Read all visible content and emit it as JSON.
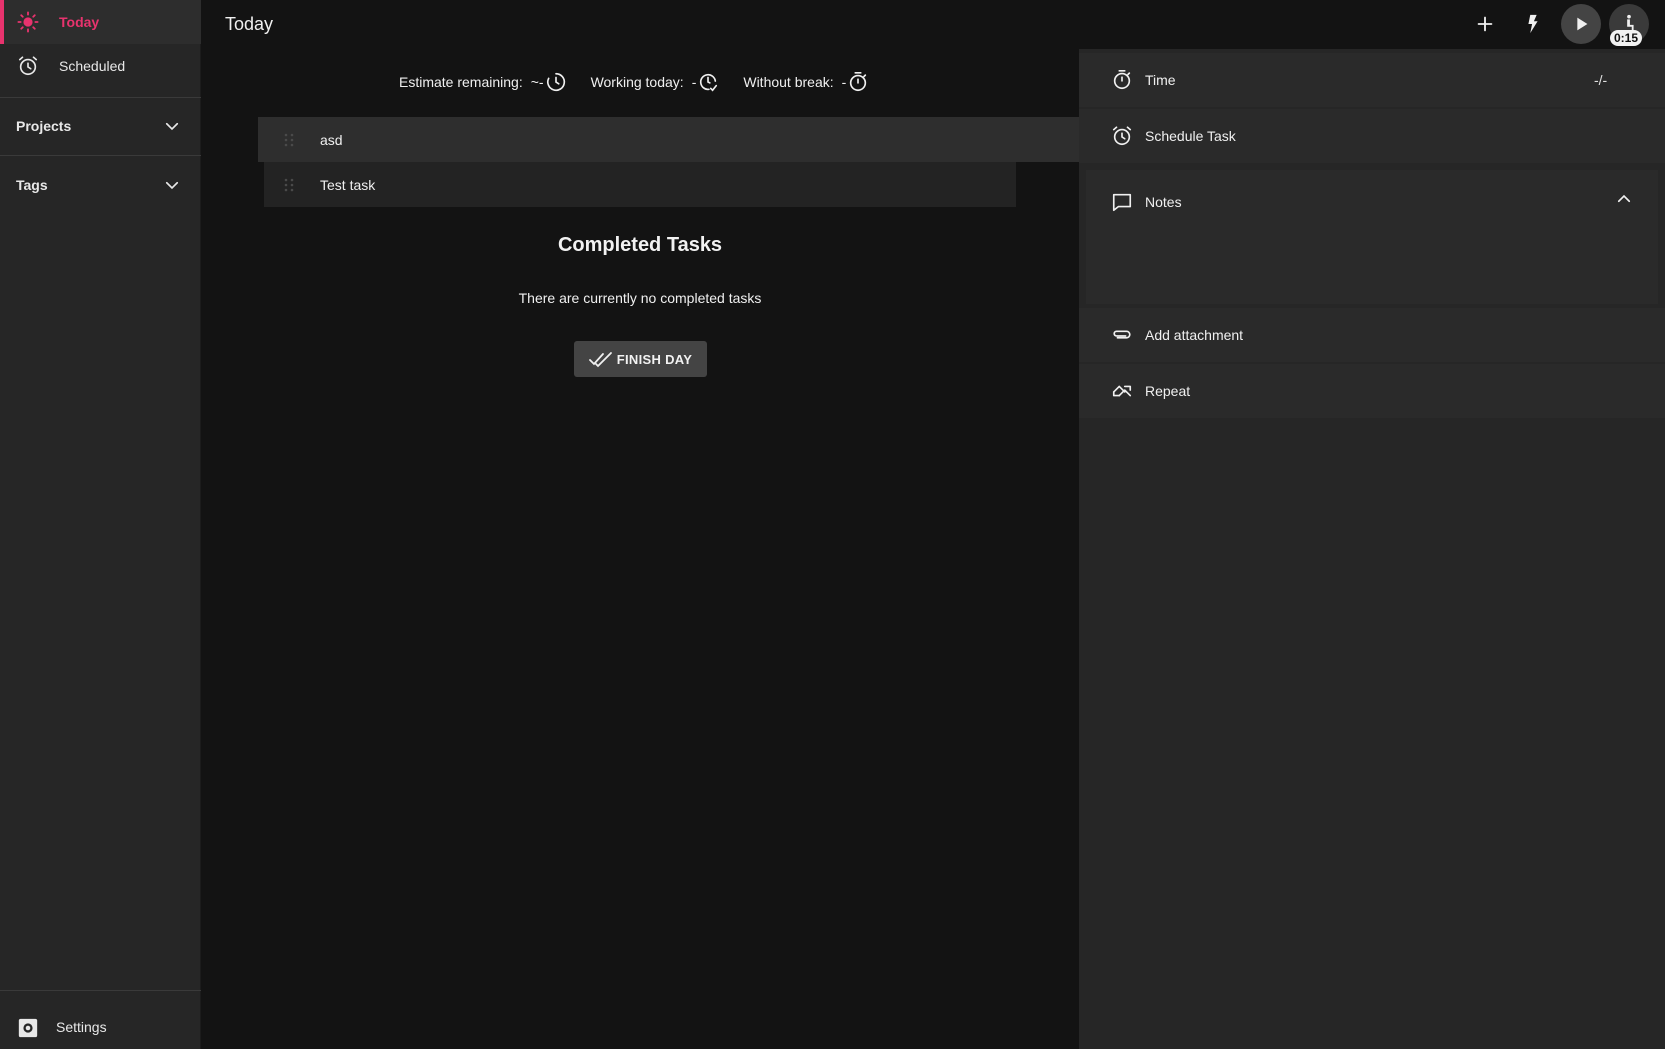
{
  "sidebar": {
    "nav": [
      {
        "label": "Today",
        "icon": "sun-icon",
        "active": true
      },
      {
        "label": "Scheduled",
        "icon": "alarm-clock-icon",
        "active": false
      }
    ],
    "sections": [
      {
        "label": "Projects",
        "icon": "chevron-down-icon"
      },
      {
        "label": "Tags",
        "icon": "chevron-down-icon"
      }
    ],
    "settings": {
      "label": "Settings",
      "icon": "settings-icon"
    }
  },
  "header": {
    "title": "Today",
    "actions": [
      "plus-icon",
      "lightning-icon",
      "play-icon",
      "break-icon"
    ],
    "timer_badge": "0:15"
  },
  "metrics": [
    {
      "label": "Estimate remaining:",
      "value": "~-",
      "icon": "clock-icon"
    },
    {
      "label": "Working today:",
      "value": "-",
      "icon": "clock-check-icon"
    },
    {
      "label": "Without break:",
      "value": "-",
      "icon": "stopwatch-icon"
    }
  ],
  "tasks": [
    {
      "title": "asd",
      "selected": true
    },
    {
      "title": "Test task",
      "selected": false
    }
  ],
  "completed": {
    "title": "Completed Tasks",
    "empty_text": "There are currently no completed tasks",
    "finish_label": "FINISH DAY"
  },
  "detail_panel": {
    "time": {
      "label": "Time",
      "value": "-/-",
      "icon": "stopwatch-icon"
    },
    "schedule": {
      "label": "Schedule Task",
      "icon": "alarm-clock-icon"
    },
    "notes": {
      "label": "Notes",
      "icon": "comment-icon"
    },
    "attachment": {
      "label": "Add attachment",
      "icon": "paperclip-icon"
    },
    "repeat": {
      "label": "Repeat",
      "icon": "repeat-icon"
    }
  },
  "colors": {
    "accent": "#e8336e",
    "background": "#131313",
    "sidebar": "#262626",
    "panel": "#262626"
  }
}
